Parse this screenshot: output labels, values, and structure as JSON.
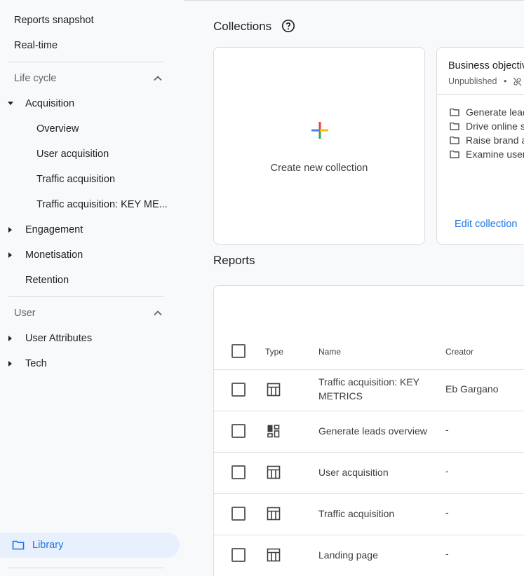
{
  "sidebar": {
    "top_items": [
      "Reports snapshot",
      "Real-time"
    ],
    "lifecycle": {
      "heading": "Life cycle",
      "acquisition": "Acquisition",
      "acquisition_children": [
        "Overview",
        "User acquisition",
        "Traffic acquisition",
        "Traffic acquisition: KEY ME..."
      ],
      "engagement": "Engagement",
      "monetisation": "Monetisation",
      "retention": "Retention"
    },
    "user": {
      "heading": "User",
      "items": [
        "User Attributes",
        "Tech"
      ]
    },
    "library": "Library"
  },
  "collections": {
    "title": "Collections",
    "create_label": "Create new collection",
    "business": {
      "title": "Business objectiv",
      "status": "Unpublished",
      "bullet": "•",
      "objectives": [
        "Generate lead",
        "Drive online s",
        "Raise brand a",
        "Examine user"
      ],
      "edit_label": "Edit collection"
    }
  },
  "reports": {
    "title": "Reports",
    "headers": {
      "type": "Type",
      "name": "Name",
      "creator": "Creator"
    },
    "rows": [
      {
        "icon": "table-icon",
        "name": "Traffic acquisition: KEY METRICS",
        "creator": "Eb Gargano"
      },
      {
        "icon": "dashboard-icon",
        "name": "Generate leads overview",
        "creator": "-"
      },
      {
        "icon": "table-icon",
        "name": "User acquisition",
        "creator": "-"
      },
      {
        "icon": "table-icon",
        "name": "Traffic acquisition",
        "creator": "-"
      },
      {
        "icon": "table-icon",
        "name": "Landing page",
        "creator": "-"
      }
    ]
  },
  "colors": {
    "accent": "#1a73e8",
    "library_bg": "#e8f0fe",
    "plus_blue": "#4285f4",
    "plus_red": "#ea4335",
    "plus_yellow": "#fbbc04",
    "plus_green": "#34a853"
  }
}
